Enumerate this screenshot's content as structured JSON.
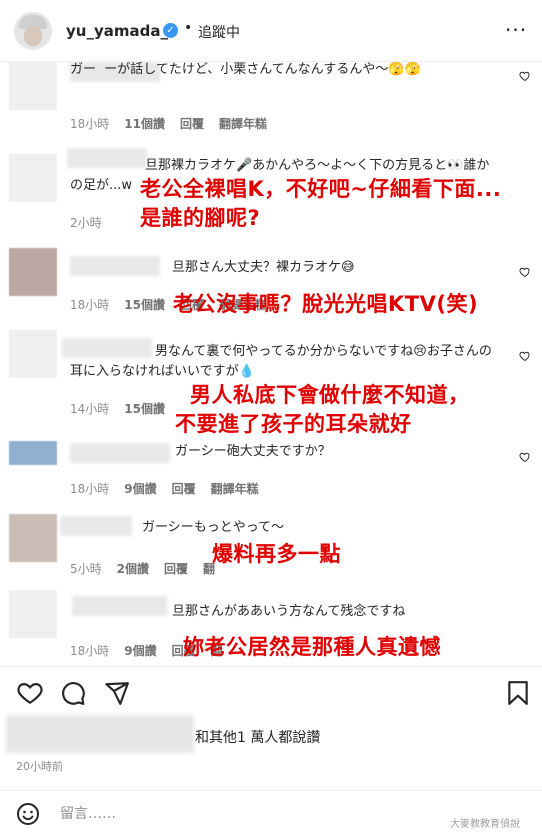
{
  "header": {
    "username": "yu_yamada_",
    "verified_glyph": "✓",
    "separator": "•",
    "follow_status": "追蹤中",
    "more_glyph": "···"
  },
  "comments": [
    {
      "text": "ガー  ーが話してたけど、小栗さんてんなんするんや～🫣🫣",
      "time": "18小時",
      "likes": "11個讚",
      "reply": "回覆",
      "translate": "翻譯年糕"
    },
    {
      "text": "旦那裸カラオケ🎤あかんやろ～よ～く下の方見ると👀誰かの足が...w",
      "time": "2小時",
      "likes": "",
      "reply": "",
      "translate": "",
      "overlay": [
        "老公全裸唱K，不好吧~仔細看下面...",
        "是誰的腳呢?"
      ]
    },
    {
      "text": "旦那さん大丈夫？裸カラオケ😅",
      "time": "18小時",
      "likes": "15個讚",
      "reply": "回覆",
      "translate": "翻譯年糕",
      "overlay": [
        "老公沒事嗎？脫光光唱KTV(笑)"
      ]
    },
    {
      "text": "男なんて裏で何やってるか分からないですね😢お子さんの耳に入らなければいいですが💧",
      "time": "14小時",
      "likes": "15個讚",
      "reply": "",
      "translate": "",
      "overlay": [
        "男人私底下會做什麼不知道，",
        "不要進了孩子的耳朵就好"
      ]
    },
    {
      "text": "ガーシー砲大丈夫ですか？",
      "time": "18小時",
      "likes": "9個讚",
      "reply": "回覆",
      "translate": "翻譯年糕"
    },
    {
      "text": "ガーシーもっとやって～",
      "time": "5小時",
      "likes": "2個讚",
      "reply": "回覆",
      "translate": "翻",
      "overlay": [
        "爆料再多一點"
      ]
    },
    {
      "text": "旦那さんがああいう方なんて残念ですね",
      "time": "18小時",
      "likes": "9個讚",
      "reply": "回覆",
      "translate": "翻",
      "overlay": [
        "妳老公居然是那種人真遺憾"
      ]
    }
  ],
  "actions": {
    "like_icon": "heart-icon",
    "comment_icon": "comment-icon",
    "share_icon": "send-icon",
    "save_icon": "bookmark-icon"
  },
  "likes_summary": "和其他1 萬人都說讚",
  "post_time": "20小時前",
  "composer": {
    "emoji_icon": "smile-icon",
    "placeholder": "留言……"
  },
  "watermark": "大麥教教育偵說",
  "colors": {
    "overlay": "#e00000",
    "meta": "#8e8e8e",
    "verified": "#3897f0"
  }
}
